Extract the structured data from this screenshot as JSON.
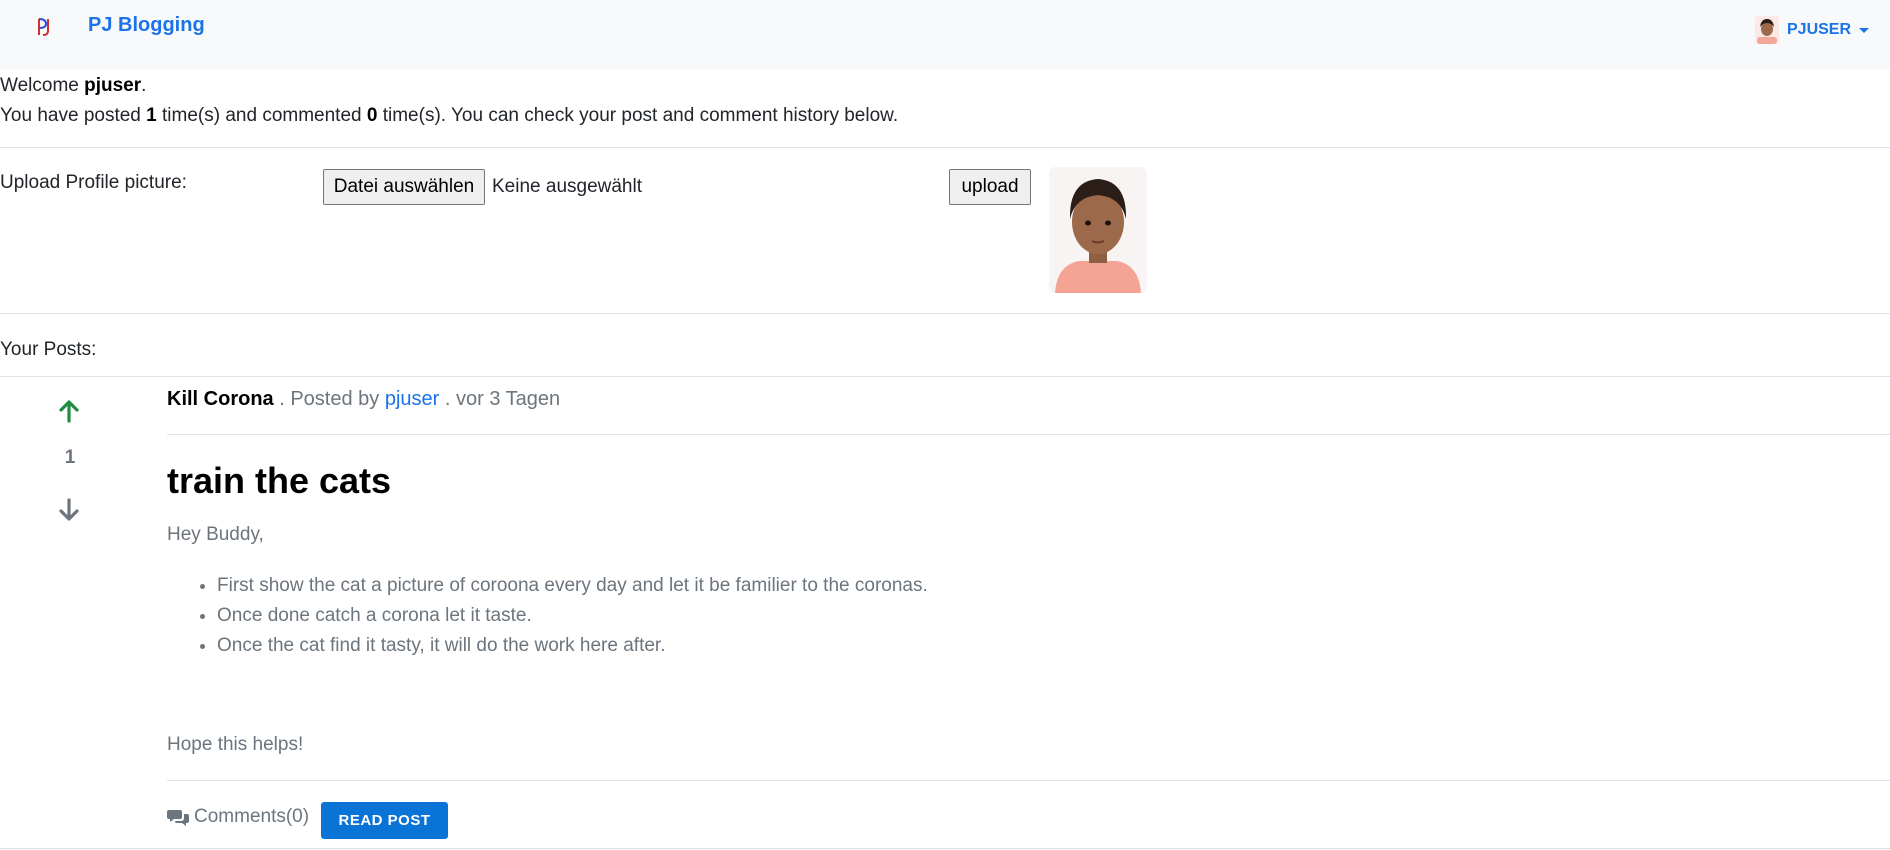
{
  "navbar": {
    "brand_name": "PJ Blogging",
    "username": "PJUSER",
    "icons": {
      "logo": "pj-logo-icon",
      "avatar": "user-avatar-image",
      "caret": "chevron-down-icon"
    }
  },
  "welcome": {
    "prefix": "Welcome ",
    "username": "pjuser",
    "suffix": ".",
    "stats_prefix": "You have posted ",
    "post_count": "1",
    "stats_middle": " time(s) and commented ",
    "comment_count": "0",
    "stats_suffix": " time(s). You can check your post and comment history below."
  },
  "upload": {
    "label": "Upload Profile picture:",
    "choose_file_label": "Datei auswählen",
    "file_status": "Keine ausgewählt",
    "upload_label": "upload"
  },
  "posts_section": {
    "label": "Your Posts:"
  },
  "post": {
    "votes": "1",
    "category": "Kill Corona",
    "meta_sep1": " . Posted by ",
    "author": "pjuser",
    "meta_sep2": " . vor 3 Tagen",
    "title": "train the cats",
    "greeting": "Hey Buddy,",
    "list_items": [
      "First show the cat a picture of coroona every day and let it be familier to the coronas.",
      "Once done catch a corona let it taste.",
      "Once the cat find it tasty, it will do the work here after."
    ],
    "closing": "Hope this helps!",
    "comments_label": "Comments(0)",
    "read_button_label": "READ POST"
  },
  "colors": {
    "accent": "#1a73e8",
    "button_primary": "#0a74d6",
    "upvote": "#1e8e3e",
    "muted": "#6c757d"
  }
}
